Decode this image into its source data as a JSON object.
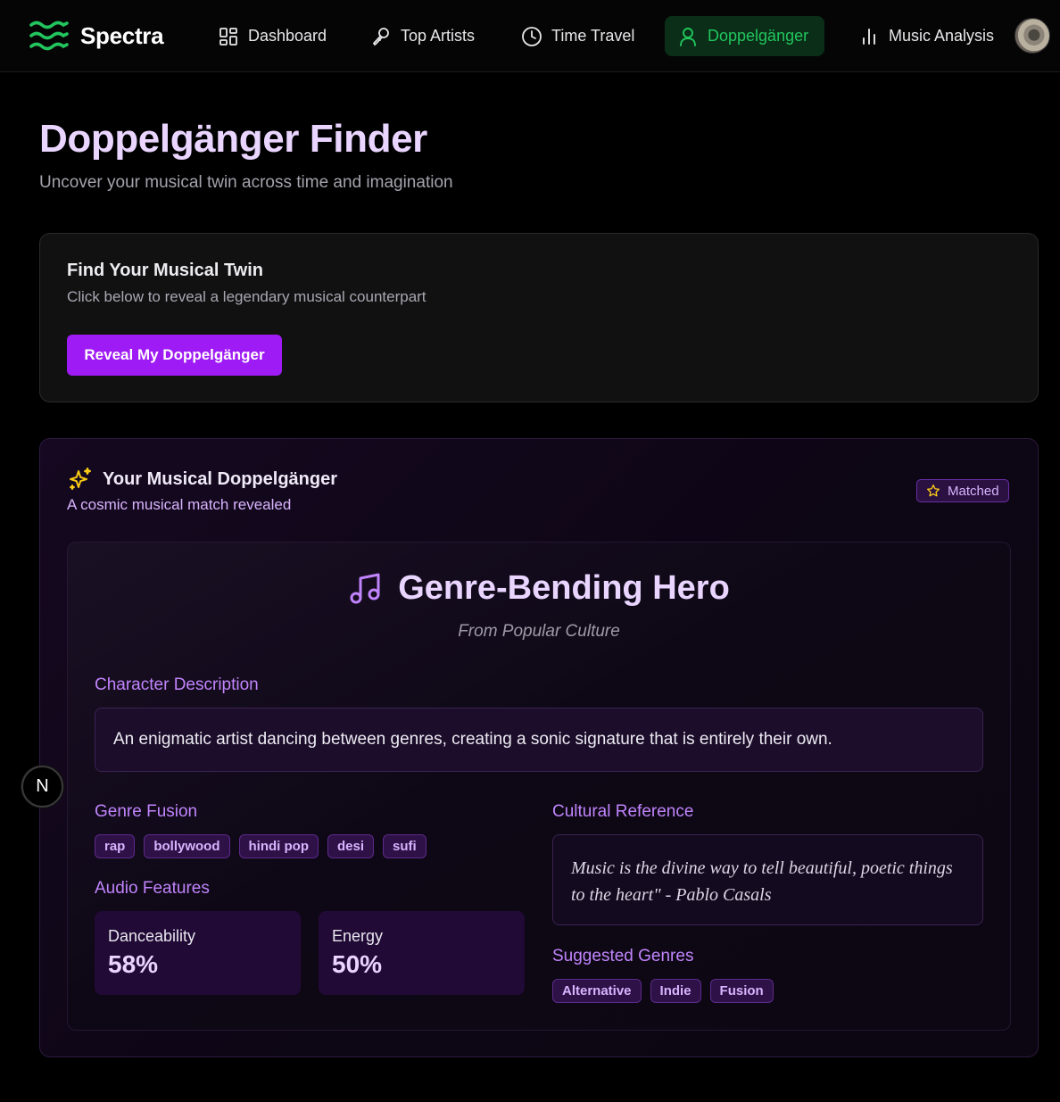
{
  "brand": {
    "name": "Spectra",
    "accent": "#22c55e"
  },
  "nav": {
    "items": [
      {
        "label": "Dashboard",
        "icon": "grid-icon"
      },
      {
        "label": "Top Artists",
        "icon": "microphone-icon"
      },
      {
        "label": "Time Travel",
        "icon": "clock-icon"
      },
      {
        "label": "Doppelgänger",
        "icon": "user-icon",
        "active": true
      },
      {
        "label": "Music Analysis",
        "icon": "bar-chart-icon"
      }
    ]
  },
  "page": {
    "title": "Doppelgänger Finder",
    "subtitle": "Uncover your musical twin across time and imagination"
  },
  "finder": {
    "title": "Find Your Musical Twin",
    "description": "Click below to reveal a legendary musical counterpart",
    "button_label": "Reveal My Doppelgänger"
  },
  "result": {
    "title": "Your Musical Doppelgänger",
    "subtitle": "A cosmic musical match revealed",
    "badge": "Matched",
    "character_name": "Genre-Bending Hero",
    "origin": "From Popular Culture",
    "description_label": "Character Description",
    "description": "An enigmatic artist dancing between genres, creating a sonic signature that is entirely their own.",
    "genre_fusion_label": "Genre Fusion",
    "genre_fusion": [
      "rap",
      "bollywood",
      "hindi pop",
      "desi",
      "sufi"
    ],
    "audio_features_label": "Audio Features",
    "audio_features": [
      {
        "label": "Danceability",
        "value": "58%"
      },
      {
        "label": "Energy",
        "value": "50%"
      }
    ],
    "cultural_reference_label": "Cultural Reference",
    "cultural_reference": "Music is the divine way to tell beautiful, poetic things to the heart\" - Pablo Casals",
    "suggested_genres_label": "Suggested Genres",
    "suggested_genres": [
      "Alternative",
      "Indie",
      "Fusion"
    ]
  },
  "floating_badge": {
    "letter": "N"
  }
}
